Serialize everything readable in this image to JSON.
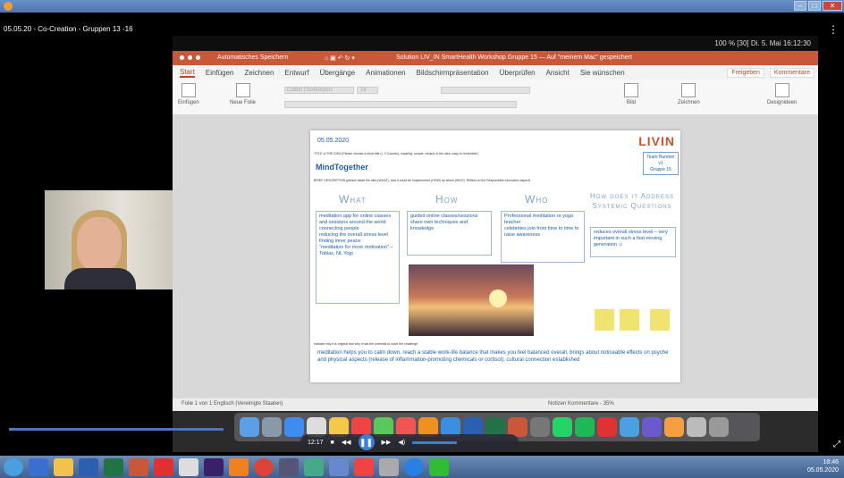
{
  "player": {
    "video_title": "05.05.20 - Co-Creation - Gruppen 13 -16",
    "time": "12:17"
  },
  "mac_menubar": {
    "status": "100 % [30]  Di. 5. Mai 16:12:30"
  },
  "ppt": {
    "autosave": "Automatisches Speichern",
    "doc_title": "Solution LIV_IN SmartHealth Workshop Gruppe 15 — Auf \"meinem Mac\" gespeichert",
    "tabs": [
      "Start",
      "Einfügen",
      "Zeichnen",
      "Entwurf",
      "Übergänge",
      "Animationen",
      "Bildschirmpräsentation",
      "Überprüfen",
      "Ansicht",
      "Sie wünschen"
    ],
    "share": "Freigeben",
    "comments": "Kommentare",
    "ribbon": {
      "paste": "Einfügen",
      "new_slide": "Neue Folie",
      "font": "Calibri (Textkörper)",
      "size": "18",
      "image": "Bild",
      "drawing": "Zeichnen",
      "ideas": "Designideen"
    },
    "status_left": "Folie 1 von 1   Englisch (Vereinigte Staaten)",
    "status_right": "Notizen   Kommentare   -  35%"
  },
  "slide": {
    "date": "05.05.2020",
    "logo": "LIVIN",
    "title_label": "TITLE of THE IDEA (Please choose a short title (< 2-3 words), inspiring, unique, remind of the idea, easy to remember)",
    "group": [
      "Team Number",
      "v1",
      "Gruppe 15"
    ],
    "name": "MindTogether",
    "brief_label": "BRIEF DESCRIPTION (please detail the idea (WHAT), how it could be implemented (HOW) by whom (WHO). Reflect on the Responsible Innovation aspect)",
    "headings": {
      "what": "What",
      "how": "How",
      "who": "Who",
      "systemic": "How does it Address Systemic Questions"
    },
    "what_items": [
      "meditation app for online classes and sessions around the world",
      "connecting people",
      "reducing the overall stress level",
      "finding inner peace",
      "\"meditation for more motivation\" – Tobias, NL Yogi"
    ],
    "how_items": [
      "guided online classes/sessions",
      "share own techniques and knowledge"
    ],
    "who_items": [
      "Professional meditation or yoga teacher",
      "celebrities join from time to time to raise awareness"
    ],
    "systemic_text": "reduces overall stress level – very important in such a fast-moving generation ☺",
    "why_label": "Indicate why it is original and why it has the potential to solve the challenge",
    "why_text": "meditation helps you to calm down, reach a stable work-life balance that makes you feel balanced overall, brings about noticeable effects on psyche and physical aspects (release of inflammation-promoting chemicals or cortisol); cultural connection established"
  },
  "taskbar": {
    "clock": "18:46",
    "date": "05.05.2020"
  }
}
